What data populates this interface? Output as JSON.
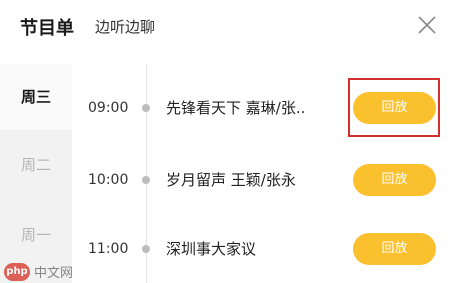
{
  "header": {
    "title": "节目单",
    "subtitle": "边听边聊",
    "close_icon": "close-icon"
  },
  "days": [
    {
      "label": "周三",
      "active": true
    },
    {
      "label": "周二",
      "active": false
    },
    {
      "label": "周一",
      "active": false
    }
  ],
  "programs": [
    {
      "time": "09:00",
      "title": "先锋看天下  嘉琳/张..",
      "action": "回放"
    },
    {
      "time": "10:00",
      "title": "岁月留声  王颖/张永",
      "action": "回放"
    },
    {
      "time": "11:00",
      "title": "深圳事大家议",
      "action": "回放"
    }
  ],
  "watermark": {
    "logo": "php",
    "text": "中文网"
  },
  "colors": {
    "accent": "#fbc02d",
    "highlight": "#d32f2f",
    "sidebar_bg": "#f2f2f2"
  }
}
